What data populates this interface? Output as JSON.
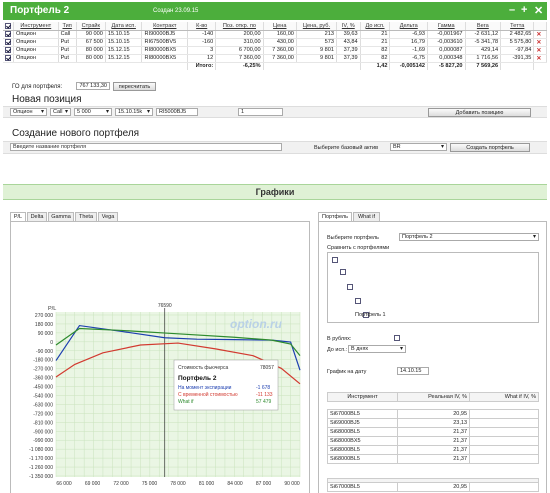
{
  "header": {
    "title": "Портфель 2",
    "created": "Создан 23.09.15",
    "controls": [
      "–",
      "+",
      "✕"
    ],
    "right_hint": "+/-"
  },
  "positions": {
    "columns": [
      "Инструмент",
      "Тип",
      "Страйк",
      "Дата исп.",
      "Контракт",
      "К-во",
      "Поз. откр. по",
      "Цена",
      "Цена, руб.",
      "IV, %",
      "До исп.",
      "Дельта",
      "Гамма",
      "Вега",
      "Тетта"
    ],
    "rows": [
      [
        "Опцион",
        "Call",
        "90 000",
        "15.10.15",
        "RI90000BJ5",
        "-140",
        "200,00",
        "160,00",
        "213",
        "39,63",
        "21",
        "-6,93",
        "-0,001967",
        "-2 631,12",
        "2 482,65"
      ],
      [
        "Опцион",
        "Put",
        "67 500",
        "15.10.15",
        "RI67500BV5",
        "-160",
        "310,00",
        "430,00",
        "573",
        "43,84",
        "21",
        "16,79",
        "-0,003610",
        "-5 341,78",
        "5 575,80"
      ],
      [
        "Опцион",
        "Put",
        "80 000",
        "15.12.15",
        "RI80000BX5",
        "3",
        "6 700,00",
        "7 360,00",
        "9 801",
        "37,39",
        "82",
        "-1,69",
        "0,000087",
        "429,14",
        "-97,84"
      ],
      [
        "Опцион",
        "Put",
        "80 000",
        "15.12.15",
        "RI80000BX5",
        "12",
        "7 360,00",
        "7 360,00",
        "9 801",
        "37,39",
        "82",
        "-6,75",
        "0,000348",
        "1 716,56",
        "-391,35"
      ]
    ],
    "totals": {
      "label": "Итого:",
      "pct": "-6,25%",
      "delta": "1,42",
      "gamma": "-0,005142",
      "vega": "-5 827,20",
      "theta": "7 569,26"
    }
  },
  "go": {
    "label": "ГО для портфеля:",
    "value": "767 133,30",
    "button": "пересчитать"
  },
  "new_position": {
    "title": "Новая позиция",
    "type": "Опцион",
    "kind": "Call",
    "strike": "5 000",
    "date": "15.10.15k",
    "contract": "RI5000BJ5",
    "qty": "1",
    "button": "Добавить позицию"
  },
  "new_portfolio": {
    "title": "Создание нового портфеля",
    "name_placeholder": "Введите название портфеля",
    "asset_label": "Выберите базовый актив",
    "asset": "BR",
    "button": "Создать портфель"
  },
  "charts_title": "Графики",
  "chart_tabs": [
    "P/L",
    "Delta",
    "Gamma",
    "Theta",
    "Vega"
  ],
  "right_tabs": [
    "Портфель",
    "What if"
  ],
  "right": {
    "choose_label": "Выберите портфель",
    "choose_value": "Портфель 2",
    "compare_label": "Сравнить с портфелями",
    "compare_item": "Портфель 1",
    "rub_label": "В рублях:",
    "until_label": "До исп.:",
    "until_value": "В днях",
    "date_label": "График на дату",
    "date_value": "14.10.15",
    "table_cols": [
      "Инструмент",
      "Реальная IV, %",
      "What if IV, %"
    ],
    "table_rows": [
      [
        "Si67000BL5",
        "20,95"
      ],
      [
        "Si69000BJ5",
        "23,13"
      ],
      [
        "Si68000BL5",
        "21,37"
      ],
      [
        "Si68000BX5",
        "21,37"
      ],
      [
        "Si68000BL5",
        "21,37"
      ],
      [
        "Si68000BL5",
        "21,37"
      ]
    ],
    "last_row": [
      "Si67000BL5",
      "20,95"
    ]
  },
  "chart": {
    "ylabel": "P/L",
    "watermark": "option.ru",
    "tooltip": {
      "title": "Стоимость фьючерса",
      "value": "78057",
      "portfolio": "Портфель 2",
      "line1": "На момент экспирации",
      "v1": "-1 678",
      "line2": "С временной стоимостью",
      "v2": "-11 133",
      "line3": "What if",
      "v3": "57 479"
    }
  },
  "chart_data": {
    "type": "line",
    "xlabel": "",
    "ylabel": "P/L",
    "x_ticks": [
      "66 000",
      "69 000",
      "72 000",
      "75 000",
      "78 000",
      "81 000",
      "84 000",
      "87 000",
      "90 000"
    ],
    "y_ticks": [
      "270 000",
      "180 000",
      "90 000",
      "0",
      "-90 000",
      "-180 000",
      "-270 000",
      "-360 000",
      "-450 000",
      "-540 000",
      "-630 000",
      "-720 000",
      "-810 000",
      "-900 000",
      "-990 000",
      "-1 080 000",
      "-1 170 000",
      "-1 260 000",
      "-1 350 000"
    ],
    "marker": "76590",
    "xlim": [
      65000,
      91000
    ],
    "ylim": [
      -1400000,
      300000
    ],
    "series": [
      {
        "name": "На момент экспирации",
        "color": "#1d3fb0",
        "x": [
          65000,
          67500,
          72000,
          76590,
          80000,
          84000,
          88000,
          90000,
          91000
        ],
        "y": [
          -200000,
          160000,
          100000,
          35000,
          20000,
          15000,
          10000,
          -10000,
          -300000
        ]
      },
      {
        "name": "С временной стоимостью",
        "color": "#d23a30",
        "x": [
          65000,
          67000,
          70000,
          74000,
          78000,
          82000,
          86000,
          89000,
          91000
        ],
        "y": [
          -370000,
          -240000,
          -120000,
          -40000,
          -20000,
          -80000,
          -150000,
          -280000,
          -440000
        ]
      },
      {
        "name": "What if",
        "color": "#2e8b2e",
        "x": [
          65000,
          67500,
          72000,
          78000,
          84000,
          88000,
          90000,
          91000
        ],
        "y": [
          -40000,
          130000,
          110000,
          75000,
          40000,
          10000,
          -30000,
          -150000
        ]
      }
    ]
  }
}
